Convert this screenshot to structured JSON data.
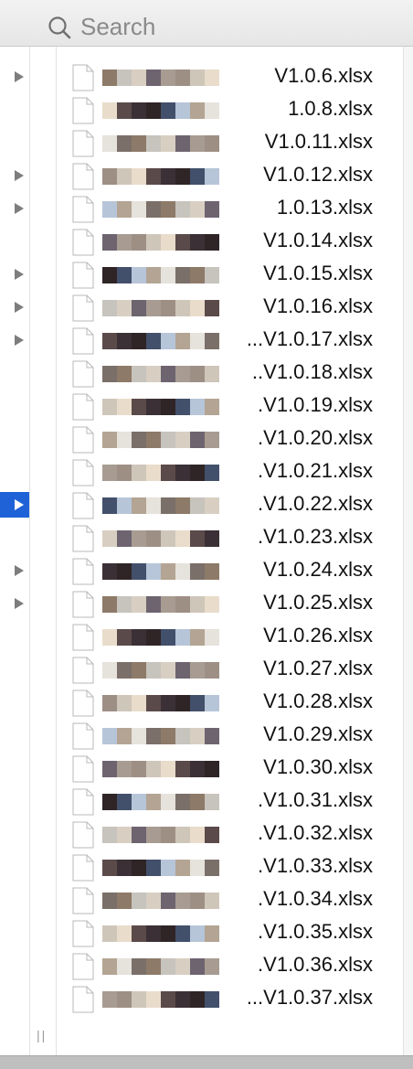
{
  "search": {
    "placeholder": "Search"
  },
  "colors": {
    "selection": "#1f62d8",
    "disclosure": "#7d7d7d"
  },
  "resize_grip": "||",
  "disclosure_rows": [
    0,
    3,
    4,
    6,
    7,
    8,
    15,
    16
  ],
  "selected_row": 13,
  "files": [
    {
      "name": "V1.0.6.xlsx"
    },
    {
      "name": "1.0.8.xlsx"
    },
    {
      "name": "V1.0.11.xlsx"
    },
    {
      "name": "V1.0.12.xlsx"
    },
    {
      "name": "1.0.13.xlsx"
    },
    {
      "name": "V1.0.14.xlsx"
    },
    {
      "name": "V1.0.15.xlsx"
    },
    {
      "name": "V1.0.16.xlsx"
    },
    {
      "name": "...V1.0.17.xlsx"
    },
    {
      "name": "..V1.0.18.xlsx"
    },
    {
      "name": ".V1.0.19.xlsx"
    },
    {
      "name": ".V1.0.20.xlsx"
    },
    {
      "name": ".V1.0.21.xlsx"
    },
    {
      "name": ".V1.0.22.xlsx"
    },
    {
      "name": ".V1.0.23.xlsx"
    },
    {
      "name": "V1.0.24.xlsx"
    },
    {
      "name": "V1.0.25.xlsx"
    },
    {
      "name": "V1.0.26.xlsx"
    },
    {
      "name": "V1.0.27.xlsx"
    },
    {
      "name": "V1.0.28.xlsx"
    },
    {
      "name": "V1.0.29.xlsx"
    },
    {
      "name": "V1.0.30.xlsx"
    },
    {
      "name": ".V1.0.31.xlsx"
    },
    {
      "name": ".V1.0.32.xlsx"
    },
    {
      "name": ".V1.0.33.xlsx"
    },
    {
      "name": ".V1.0.34.xlsx"
    },
    {
      "name": ".V1.0.35.xlsx"
    },
    {
      "name": ".V1.0.36.xlsx"
    },
    {
      "name": "...V1.0.37.xlsx"
    }
  ]
}
